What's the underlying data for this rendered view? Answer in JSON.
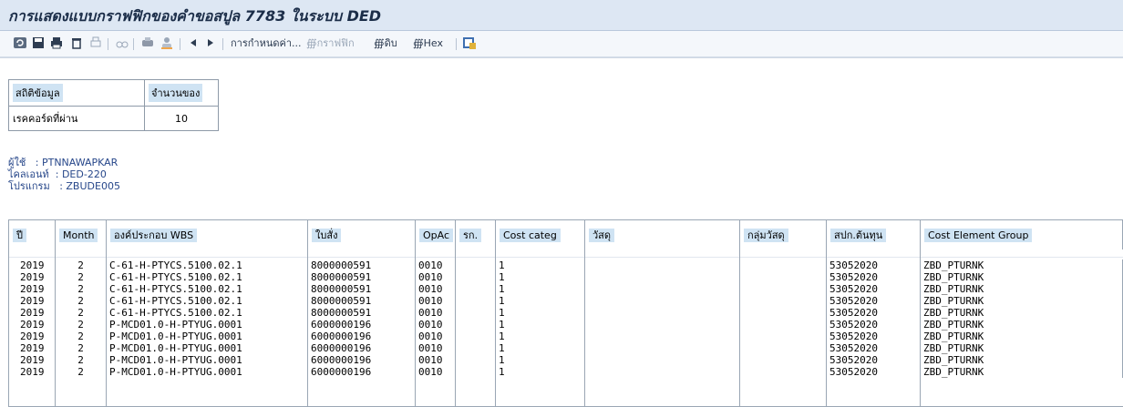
{
  "window": {
    "title": "การแสดงแบบกราฟฟิกของคำขอสปูล 7783 ในระบบ DED"
  },
  "toolbar": {
    "settings_label": "การกำหนดค่า...",
    "graphic_label": "กราฟฟิก",
    "raw_label": "ดิบ",
    "hex_label": "Hex"
  },
  "stats": {
    "header_col1": "สถิติข้อมูล",
    "header_col2": "จำนวนของ",
    "row_label": "เรคคอร์ดที่ผ่าน",
    "row_value": "10"
  },
  "info": {
    "user_line": "ผู้ใช้   : PTNNAWAPKAR",
    "client_line": "ไคลเอนท์  : DED-220",
    "program_line": "โปรแกรม   : ZBUDE005"
  },
  "table": {
    "headers": [
      "ปี",
      "Month",
      "องค์ประกอบ WBS",
      "ใบสั่ง",
      "OpAc",
      "รก.",
      "Cost categ",
      "วัสดุ",
      "กลุ่มวัสดุ",
      "สปก.ต้นทุน",
      "Cost Element Group"
    ],
    "rows": [
      [
        "2019",
        "2",
        "C-61-H-PTYCS.5100.02.1",
        "8000000591",
        "0010",
        "",
        "1",
        "",
        "",
        "53052020",
        "ZBD_PTURNK"
      ],
      [
        "2019",
        "2",
        "C-61-H-PTYCS.5100.02.1",
        "8000000591",
        "0010",
        "",
        "1",
        "",
        "",
        "53052020",
        "ZBD_PTURNK"
      ],
      [
        "2019",
        "2",
        "C-61-H-PTYCS.5100.02.1",
        "8000000591",
        "0010",
        "",
        "1",
        "",
        "",
        "53052020",
        "ZBD_PTURNK"
      ],
      [
        "2019",
        "2",
        "C-61-H-PTYCS.5100.02.1",
        "8000000591",
        "0010",
        "",
        "1",
        "",
        "",
        "53052020",
        "ZBD_PTURNK"
      ],
      [
        "2019",
        "2",
        "C-61-H-PTYCS.5100.02.1",
        "8000000591",
        "0010",
        "",
        "1",
        "",
        "",
        "53052020",
        "ZBD_PTURNK"
      ],
      [
        "2019",
        "2",
        "P-MCD01.0-H-PTYUG.0001",
        "6000000196",
        "0010",
        "",
        "1",
        "",
        "",
        "53052020",
        "ZBD_PTURNK"
      ],
      [
        "2019",
        "2",
        "P-MCD01.0-H-PTYUG.0001",
        "6000000196",
        "0010",
        "",
        "1",
        "",
        "",
        "53052020",
        "ZBD_PTURNK"
      ],
      [
        "2019",
        "2",
        "P-MCD01.0-H-PTYUG.0001",
        "6000000196",
        "0010",
        "",
        "1",
        "",
        "",
        "53052020",
        "ZBD_PTURNK"
      ],
      [
        "2019",
        "2",
        "P-MCD01.0-H-PTYUG.0001",
        "6000000196",
        "0010",
        "",
        "1",
        "",
        "",
        "53052020",
        "ZBD_PTURNK"
      ],
      [
        "2019",
        "2",
        "P-MCD01.0-H-PTYUG.0001",
        "6000000196",
        "0010",
        "",
        "1",
        "",
        "",
        "53052020",
        "ZBD_PTURNK"
      ]
    ]
  },
  "colors": {
    "title_bg": "#dde7f3",
    "header_highlight": "#cfe3f3",
    "info_text": "#27478a"
  }
}
